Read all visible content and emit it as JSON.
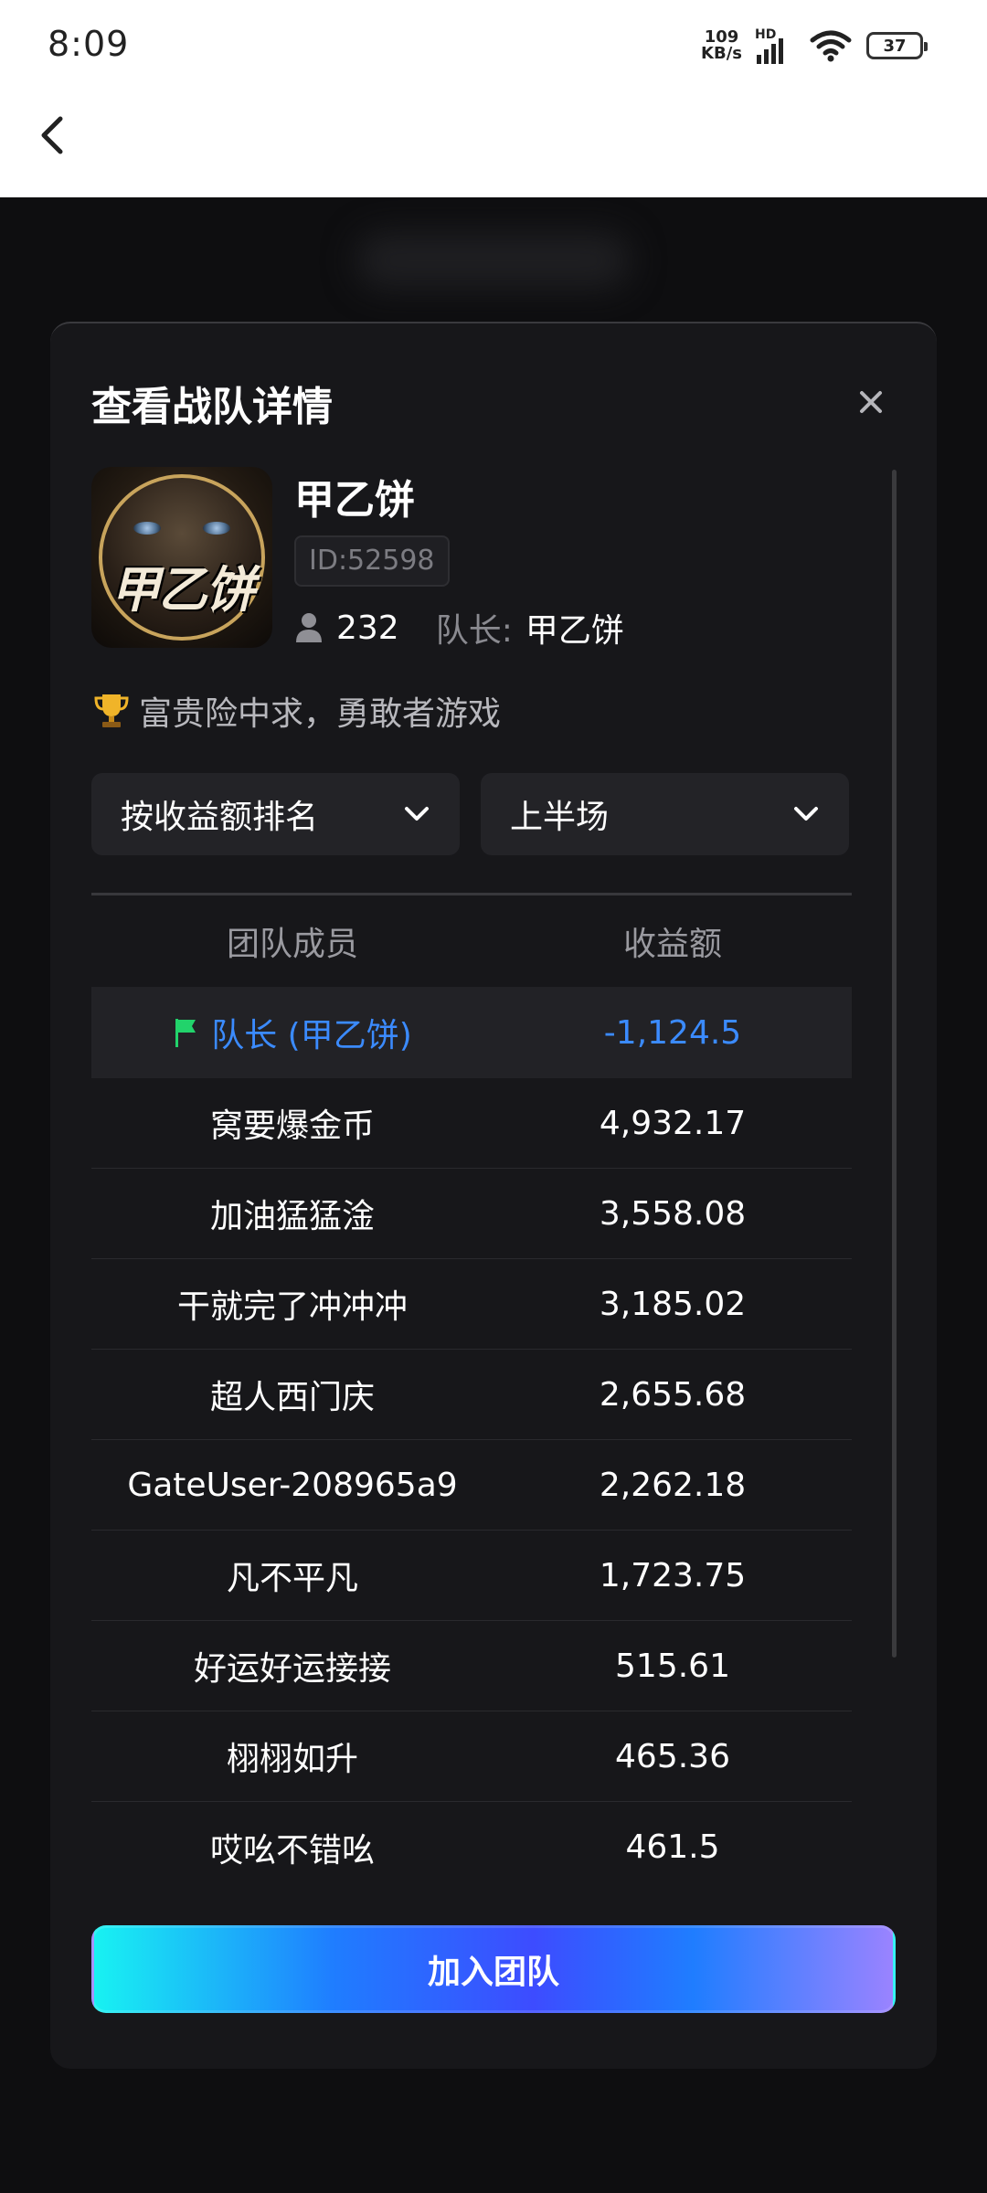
{
  "status_bar": {
    "time": "8:09",
    "net_speed_value": "109",
    "net_speed_unit": "KB/s",
    "hd_label": "HD",
    "battery": "37"
  },
  "modal": {
    "title": "查看战队详情",
    "team": {
      "name": "甲乙饼",
      "avatar_text": "甲乙饼",
      "id": "ID:52598",
      "members": "232",
      "captain_label": "队长:",
      "captain_name": "甲乙饼",
      "slogan": "富贵险中求，勇敢者游戏"
    },
    "filters": {
      "sort": "按收益额排名",
      "period": "上半场"
    },
    "table": {
      "headers": [
        "团队成员",
        "收益额"
      ],
      "captain_row": {
        "member": "队长 (甲乙饼)",
        "profit": "-1,124.5"
      },
      "rows": [
        {
          "member": "窝要爆金币",
          "profit": "4,932.17"
        },
        {
          "member": "加油猛猛淦",
          "profit": "3,558.08"
        },
        {
          "member": "干就完了冲冲冲",
          "profit": "3,185.02"
        },
        {
          "member": "超人西门庆",
          "profit": "2,655.68"
        },
        {
          "member": "GateUser-208965a9",
          "profit": "2,262.18"
        },
        {
          "member": "凡不平凡",
          "profit": "1,723.75"
        },
        {
          "member": "好运好运接接",
          "profit": "515.61"
        },
        {
          "member": "栩栩如升",
          "profit": "465.36"
        },
        {
          "member": "哎吆不错吆",
          "profit": "461.5"
        }
      ]
    },
    "join_button": "加入团队"
  },
  "colors": {
    "captain_accent": "#3b8bff",
    "flag": "#22d36b",
    "modal_bg": "#17171a"
  }
}
